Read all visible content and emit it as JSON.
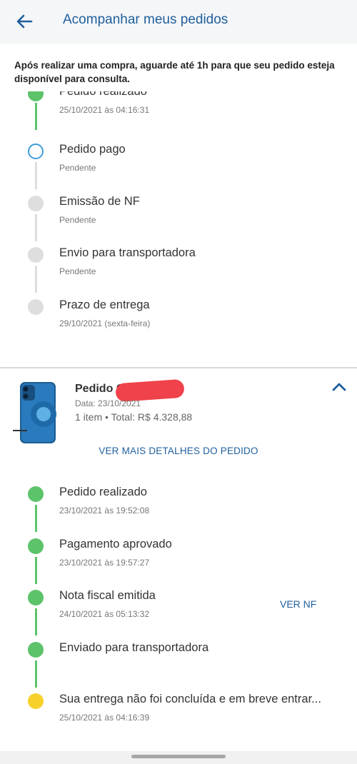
{
  "header": {
    "title": "Acompanhar meus pedidos",
    "back_icon": "arrow-left-icon"
  },
  "notice": "Após realizar uma compra, aguarde até 1h para que seu pedido esteja disponível para consulta.",
  "first_order": {
    "timeline": [
      {
        "title": "Pedido realizado",
        "sub": "25/10/2021 às 04:16:31",
        "status": "done"
      },
      {
        "title": "Pedido pago",
        "sub": "Pendente",
        "status": "current"
      },
      {
        "title": "Emissão de NF",
        "sub": "Pendente",
        "status": "pending"
      },
      {
        "title": "Envio para transportadora",
        "sub": "Pendente",
        "status": "pending"
      },
      {
        "title": "Prazo de entrega",
        "sub": "29/10/2021 (sexta-feira)",
        "status": "pending"
      }
    ]
  },
  "second_order": {
    "title": "Pedido C",
    "date": "Data: 23/10/2021",
    "summary": "1 item • Total: R$ 4.328,88",
    "details_link": "VER MAIS DETALHES DO PEDIDO",
    "ver_nf": "VER NF",
    "timeline": [
      {
        "title": "Pedido realizado",
        "sub": "23/10/2021 às 19:52:08",
        "status": "done"
      },
      {
        "title": "Pagamento aprovado",
        "sub": "23/10/2021 às 19:57:27",
        "status": "done"
      },
      {
        "title": "Nota fiscal emitida",
        "sub": "24/10/2021 às 05:13:32",
        "status": "done"
      },
      {
        "title": "Enviado para transportadora",
        "sub": "",
        "status": "done"
      },
      {
        "title": "Sua entrega não foi concluída e em breve entrar...",
        "sub": "25/10/2021 às 04:16:39",
        "status": "warning"
      }
    ]
  },
  "colors": {
    "accent": "#1f5f9c",
    "done": "#5cc36a",
    "current": "#3d9ddd",
    "pending": "#dedede",
    "warning": "#f6d12c"
  }
}
